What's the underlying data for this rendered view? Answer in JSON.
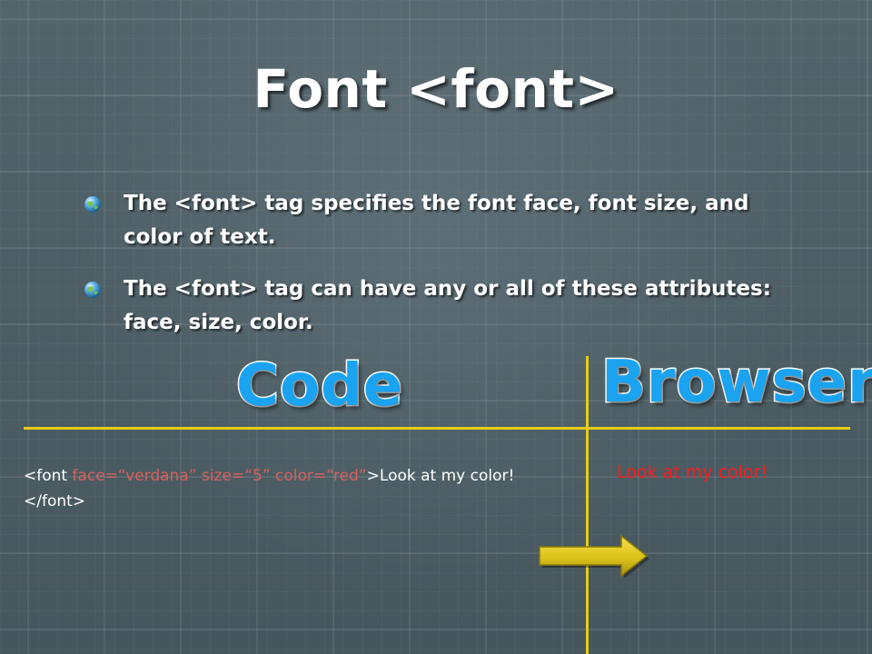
{
  "slide": {
    "title": "Font <font>",
    "bullets": [
      "The <font> tag specifies the font face, font size, and color of text.",
      "The <font> tag can have any or all of these attributes: face, size, color."
    ],
    "code_heading": "Code",
    "browser_heading": "Browser",
    "code_example": {
      "open_tag_start": "<font ",
      "face_attr": "face=“verdana” ",
      "size_attr": "size=“5” ",
      "color_attr": "color=“red”",
      "open_tag_end": ">Look at my color!</font>"
    },
    "browser_output": "Look at my color!",
    "browser_output_color": "#ff1a1a",
    "heading_color": "#1aa3f0",
    "divider_color": "#e8cc17",
    "arrow_color": "#e8cc17",
    "bullet_icon": "globe-bullet-icon",
    "arrow_icon": "right-arrow-icon"
  }
}
